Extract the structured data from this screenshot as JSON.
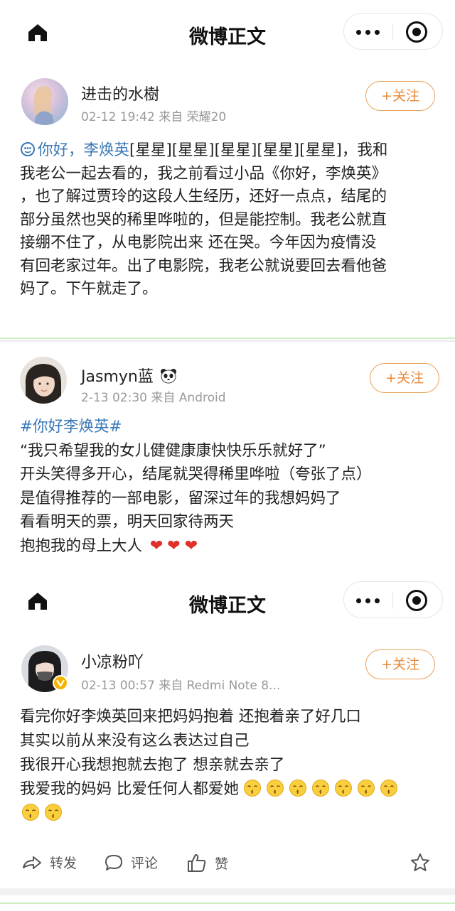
{
  "nav": {
    "title": "微博正文"
  },
  "posts": [
    {
      "username": "进击的水樹",
      "meta": "02-12 19:42  来自 荣耀20",
      "follow": "+关注",
      "blue_intro": "你好，李焕英",
      "lines": [
        "[星星][星星][星星][星星][星星]，我和",
        "我老公一起去看的，我之前看过小品《你好，李焕英》",
        "，也了解过贾玲的这段人生经历，还好一点点，结尾的",
        "部分虽然也哭的稀里哗啦的，但是能控制。我老公就直",
        "接绷不住了，从电影院出来 还在哭。今年因为疫情没",
        "有回老家过年。出了电影院，我老公就说要回去看他爸",
        "妈了。下午就走了。"
      ]
    },
    {
      "username": "Jasmyn蓝",
      "meta": "2-13 02:30  来自 Android",
      "follow": "+关注",
      "hashtag": "#你好李焕英#",
      "lines": [
        "“我只希望我的女儿健健康康快快乐乐就好了”",
        "开头笑得多开心，结尾就哭得稀里哗啦（夸张了点）",
        "是值得推荐的一部电影，留深过年的我想妈妈了",
        "看看明天的票，明天回家待两天",
        "抱抱我的母上大人"
      ],
      "emoji": "❤"
    },
    {
      "username": "小凉粉吖",
      "meta": "02-13 00:57  来自 Redmi Note 8...",
      "follow": "+关注",
      "lines": [
        "看完你好李焕英回来把妈妈抱着 还抱着亲了好几口",
        "其实以前从来没有这么表达过自己",
        "我很开心我想抱就去抱了 想亲就去亲了",
        "我爱我的妈妈 比爱任何人都爱她"
      ],
      "emoji": "😚"
    }
  ],
  "actions": {
    "repost": "转发",
    "comment": "评论",
    "like": "赞"
  },
  "colors": {
    "accent": "#e8893a",
    "link": "#3a78b8",
    "green_divider": "#b8e0a8"
  }
}
